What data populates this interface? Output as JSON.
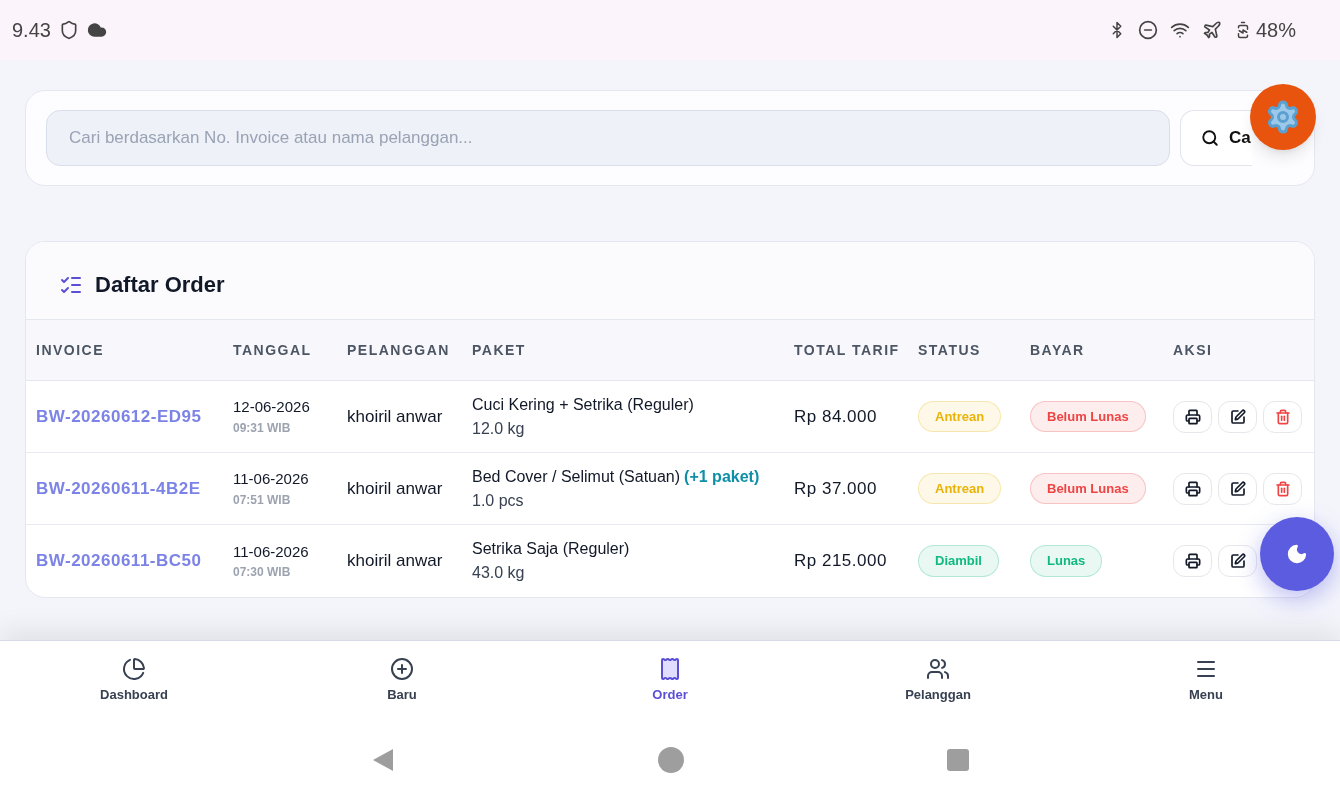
{
  "status_bar": {
    "time": "9.43",
    "battery": "48%"
  },
  "search": {
    "placeholder": "Cari berdasarkan No. Invoice atau nama pelanggan...",
    "button": "Ca"
  },
  "orders": {
    "title": "Daftar Order",
    "columns": [
      "INVOICE",
      "TANGGAL",
      "PELANGGAN",
      "PAKET",
      "TOTAL TARIF",
      "STATUS",
      "BAYAR",
      "AKSI"
    ],
    "rows": [
      {
        "invoice": "BW-20260612-ED95",
        "date": "12-06-2026",
        "time": "09:31 WIB",
        "customer": "khoiril anwar",
        "package": "Cuci Kering + Setrika (Reguler)",
        "qty": "12.0 kg",
        "total": "Rp 84.000",
        "status": {
          "text": "Antrean",
          "color": "#eab308"
        },
        "payment": {
          "text": "Belum Lunas",
          "color": "#ef4444"
        },
        "actions": [
          {
            "kind": "print"
          },
          {
            "kind": "edit"
          },
          {
            "kind": "delete"
          }
        ]
      },
      {
        "invoice": "BW-20260611-4B2E",
        "date": "11-06-2026",
        "time": "07:51 WIB",
        "customer": "khoiril anwar",
        "package": "Bed Cover / Selimut (Satuan)",
        "extra": "(+1 paket)",
        "qty": "1.0 pcs",
        "total": "Rp 37.000",
        "status": {
          "text": "Antrean",
          "color": "#eab308"
        },
        "payment": {
          "text": "Belum Lunas",
          "color": "#ef4444"
        },
        "actions": [
          {
            "kind": "print"
          },
          {
            "kind": "edit"
          },
          {
            "kind": "delete"
          }
        ]
      },
      {
        "invoice": "BW-20260611-BC50",
        "date": "11-06-2026",
        "time": "07:30 WIB",
        "customer": "khoiril anwar",
        "package": "Setrika Saja (Reguler)",
        "qty": "43.0 kg",
        "total": "Rp 215.000",
        "status": {
          "text": "Diambil",
          "color": "#10b981"
        },
        "payment": {
          "text": "Lunas",
          "color": "#10b981"
        },
        "actions": [
          {
            "kind": "print"
          },
          {
            "kind": "edit"
          }
        ]
      }
    ]
  },
  "bottom_nav": [
    {
      "label": "Dashboard",
      "selected": false
    },
    {
      "label": "Baru",
      "selected": false
    },
    {
      "label": "Order",
      "selected": true
    },
    {
      "label": "Pelanggan",
      "selected": false
    },
    {
      "label": "Menu",
      "selected": false
    }
  ]
}
